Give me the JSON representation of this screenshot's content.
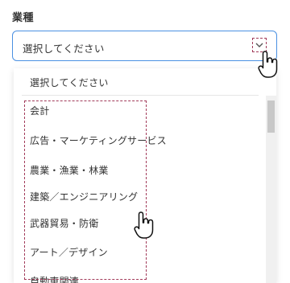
{
  "field": {
    "label": "業種",
    "value": "選択してください"
  },
  "dropdown": {
    "placeholder": "選択してください",
    "options": [
      "会計",
      "広告・マーケティングサービス",
      "農業・漁業・林業",
      "建築／エンジニアリング",
      "武器貿易・防衛",
      "アート／デザイン",
      "自動車関連"
    ]
  },
  "icons": {
    "select": "chevron-down-icon",
    "cursor": "hand-pointer-icon"
  },
  "colors": {
    "focus_border": "#4a90e2",
    "annotation": "#a23b5a"
  }
}
